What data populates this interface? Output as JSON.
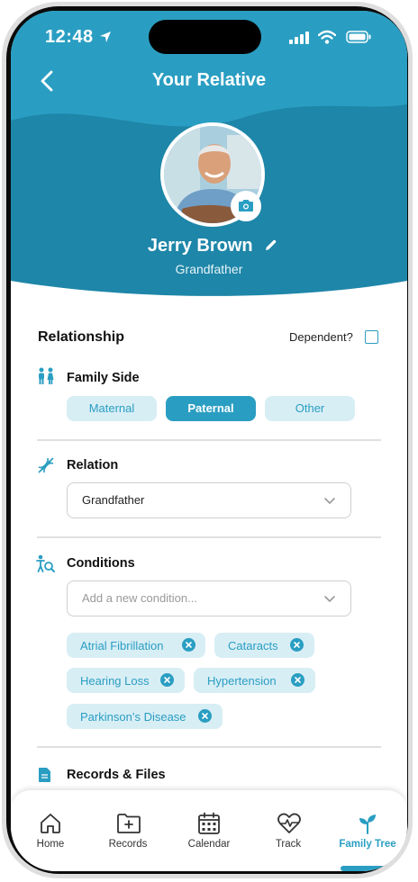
{
  "status_bar": {
    "time": "12:48"
  },
  "header": {
    "title": "Your Relative"
  },
  "profile": {
    "name": "Jerry Brown",
    "relation": "Grandfather"
  },
  "relationship": {
    "title": "Relationship",
    "dependent_label": "Dependent?",
    "dependent_checked": false,
    "family_side": {
      "label": "Family Side",
      "options": [
        "Maternal",
        "Paternal",
        "Other"
      ],
      "selected": "Paternal"
    },
    "relation": {
      "label": "Relation",
      "value": "Grandfather"
    },
    "conditions": {
      "label": "Conditions",
      "placeholder": "Add a new condition...",
      "items": [
        "Atrial Fibrillation",
        "Cataracts",
        "Hearing Loss",
        "Hypertension",
        "Parkinson’s Disease"
      ]
    },
    "records": {
      "label": "Records & Files"
    }
  },
  "tab_bar": {
    "items": [
      {
        "label": "Home",
        "icon": "home-icon"
      },
      {
        "label": "Records",
        "icon": "folder-plus-icon"
      },
      {
        "label": "Calendar",
        "icon": "calendar-icon"
      },
      {
        "label": "Track",
        "icon": "heart-pulse-icon"
      },
      {
        "label": "Family Tree",
        "icon": "sprout-icon"
      }
    ],
    "active": "Family Tree"
  },
  "colors": {
    "accent": "#2a9ec2",
    "header": "#1e86a8",
    "chip_bg": "#d8eef5"
  }
}
